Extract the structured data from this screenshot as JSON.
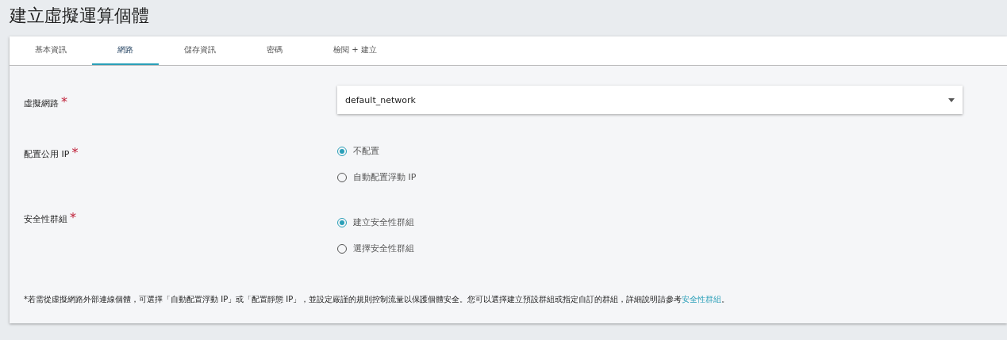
{
  "title": "建立虛擬運算個體",
  "tabs": [
    {
      "label": "基本資訊",
      "selected": false
    },
    {
      "label": "網路",
      "selected": true
    },
    {
      "label": "儲存資訊",
      "selected": false
    },
    {
      "label": "密碼",
      "selected": false
    },
    {
      "label": "檢閱 + 建立",
      "selected": false
    }
  ],
  "fields": [
    {
      "kind": "select",
      "label": "虛擬網路",
      "required": true,
      "required_mark": "*",
      "value": "default_network"
    },
    {
      "kind": "radio",
      "label": "配置公用 IP",
      "required": true,
      "required_mark": "*",
      "options": [
        {
          "label": "不配置",
          "selected": true
        },
        {
          "label": "自動配置浮動 IP",
          "selected": false
        }
      ]
    },
    {
      "kind": "radio",
      "label": "安全性群組",
      "required": true,
      "required_mark": "*",
      "options": [
        {
          "label": "建立安全性群組",
          "selected": true
        },
        {
          "label": "選擇安全性群組",
          "selected": false
        }
      ]
    }
  ],
  "note": {
    "text": "*若需從虛擬網路外部連線個體，可選擇「自動配置浮動 IP」或「配置靜態 IP」，並設定嚴謹的規則控制流量以保護個體安全。您可以選擇建立預設群組或指定自訂的群組，詳細說明請參考",
    "link": "安全性群組",
    "end": "。"
  }
}
